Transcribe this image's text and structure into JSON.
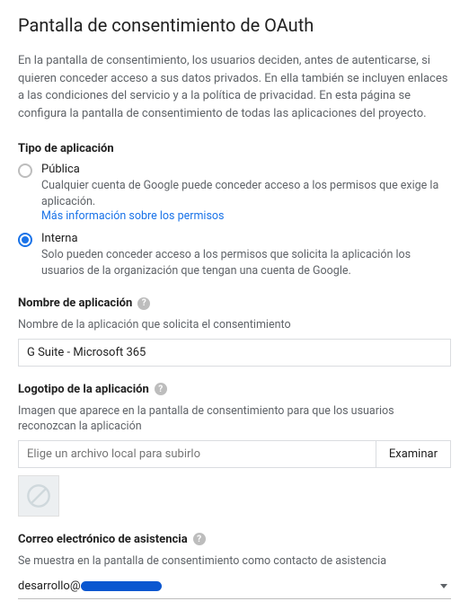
{
  "page_title": "Pantalla de consentimiento de OAuth",
  "intro": "En la pantalla de consentimiento, los usuarios deciden, antes de autenticarse, si quieren conceder acceso a sus datos privados. En ella también se incluyen enlaces a las condiciones del servicio y a la política de privacidad. En esta página se configura la pantalla de consentimiento de todas las aplicaciones del proyecto.",
  "app_type": {
    "header": "Tipo de aplicación",
    "options": [
      {
        "label": "Pública",
        "desc": "Cualquier cuenta de Google puede conceder acceso a los permisos que exige la aplicación.",
        "link": "Más información sobre los permisos",
        "checked": false
      },
      {
        "label": "Interna",
        "desc": "Solo pueden conceder acceso a los permisos que solicita la aplicación los usuarios de la organización que tengan una cuenta de Google.",
        "checked": true
      }
    ]
  },
  "app_name": {
    "header": "Nombre de aplicación",
    "desc": "Nombre de la aplicación que solicita el consentimiento",
    "value": "G Suite - Microsoft 365"
  },
  "logo": {
    "header": "Logotipo de la aplicación",
    "desc": "Imagen que aparece en la pantalla de consentimiento para que los usuarios reconozcan la aplicación",
    "placeholder": "Elige un archivo local para subirlo",
    "browse": "Examinar"
  },
  "support_email": {
    "header": "Correo electrónico de asistencia",
    "desc": "Se muestra en la pantalla de consentimiento como contacto de asistencia",
    "value_prefix": "desarrollo@"
  },
  "help_glyph": "?"
}
